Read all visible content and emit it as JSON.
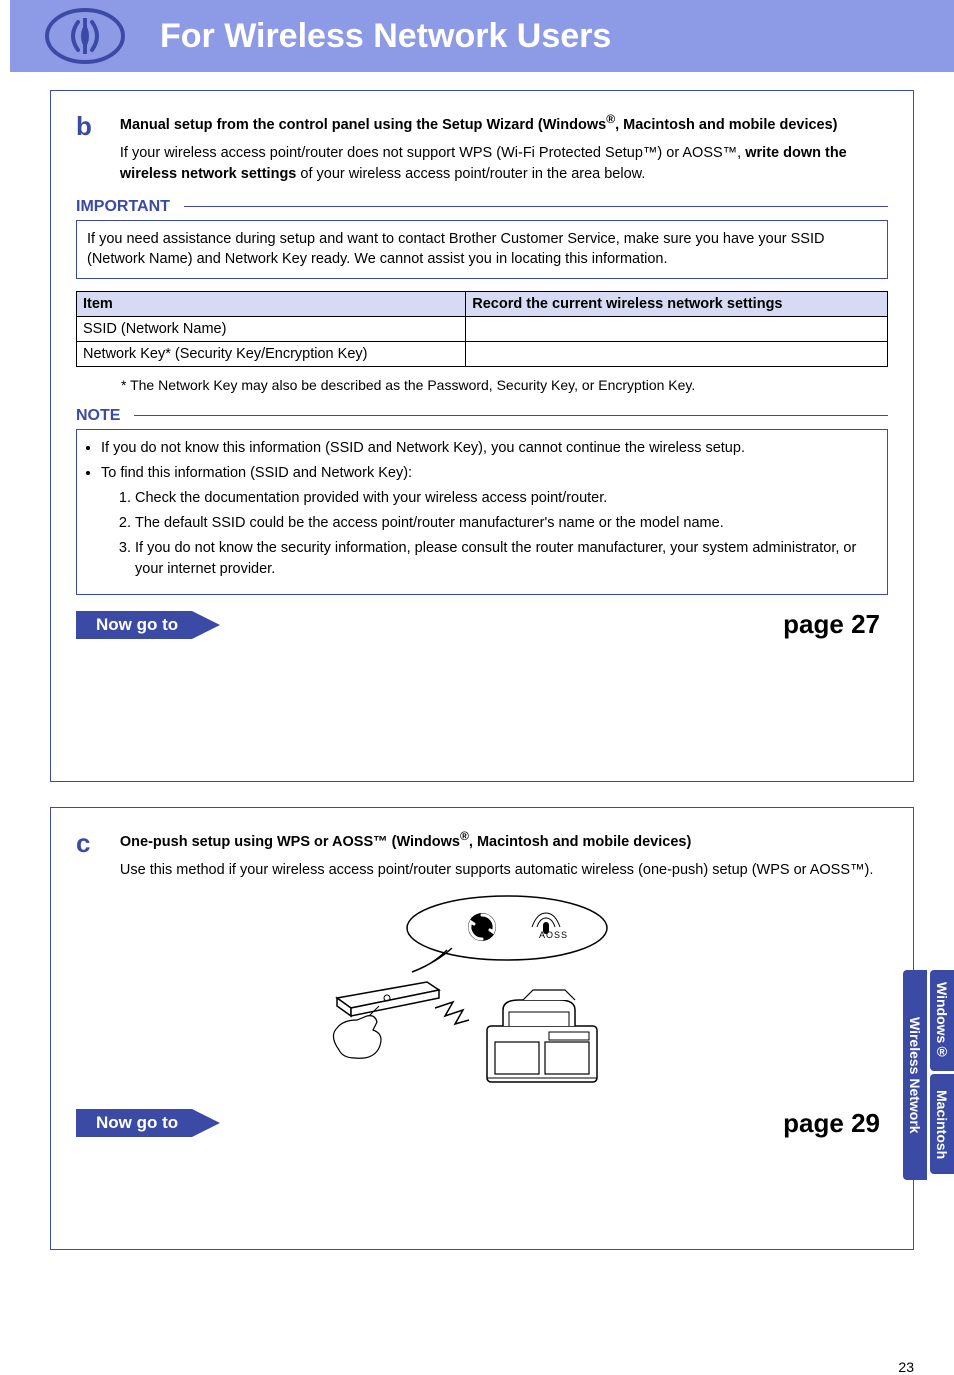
{
  "header": {
    "title": "For Wireless Network Users"
  },
  "section_b": {
    "letter": "b",
    "title_pre": "Manual setup from the control panel using the Setup Wizard (Windows",
    "title_reg1": "®",
    "title_mid": ", Macintosh and mobile devices)",
    "body_pre": "If your wireless access point/router does not support WPS (Wi-Fi Protected Setup™) or AOSS™, ",
    "body_bold": "write down the wireless network settings",
    "body_post": " of your wireless access point/router in the area below.",
    "important_label": "IMPORTANT",
    "important_text": "If you need assistance during setup and want to contact Brother Customer Service, make sure you have your SSID (Network Name) and Network Key ready. We cannot assist you in locating this information.",
    "table": {
      "h1": "Item",
      "h2": "Record the current wireless network settings",
      "r1": "SSID (Network Name)",
      "r2": "Network Key* (Security Key/Encryption Key)"
    },
    "footnote": "*   The Network Key may also be described as the Password, Security Key, or Encryption Key.",
    "note_label": "NOTE",
    "note_b1": "If you do not know this information (SSID and Network Key), you cannot continue the wireless setup.",
    "note_b2": "To find this information (SSID and Network Key):",
    "note_s1": "Check the documentation provided with your wireless access point/router.",
    "note_s2": "The default SSID could be the access point/router manufacturer's name or the model name.",
    "note_s3": "If you do not know the security information, please consult the router manufacturer, your system administrator, or your internet provider.",
    "goto_label": "Now go to",
    "goto_page": "page 27"
  },
  "section_c": {
    "letter": "c",
    "title_pre": "One-push setup using WPS or AOSS™ (Windows",
    "title_reg1": "®",
    "title_mid": ", Macintosh and mobile devices)",
    "body": "Use this method if your wireless access point/router supports automatic wireless (one-push) setup (WPS or AOSS™).",
    "aoss_label": "AOSS",
    "goto_label": "Now go to",
    "goto_page": "page 29"
  },
  "side_tabs": {
    "windows": "Windows®",
    "mac": "Macintosh",
    "wireless": "Wireless Network"
  },
  "page_number": "23"
}
